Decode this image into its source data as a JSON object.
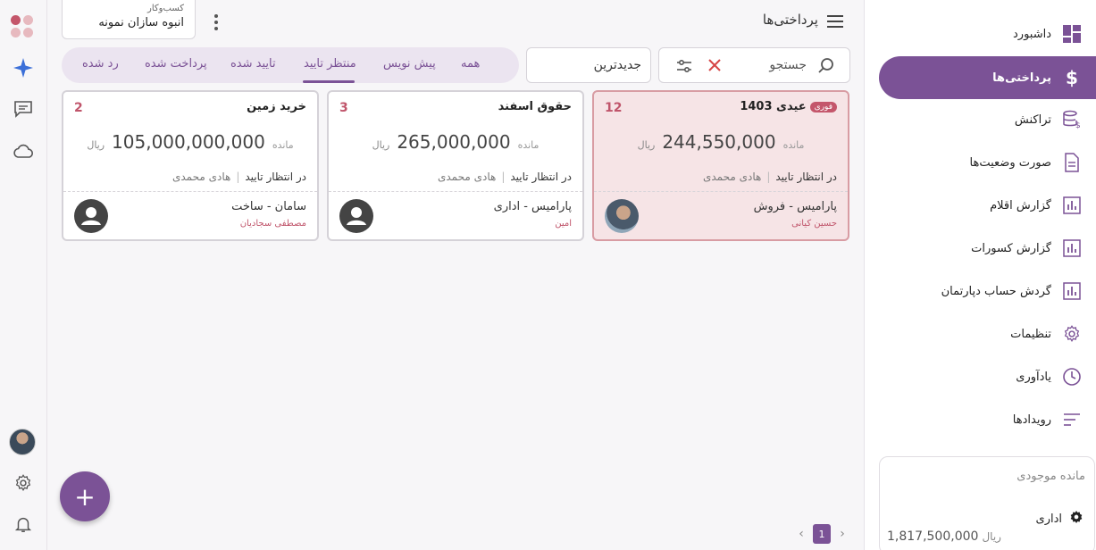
{
  "header": {
    "title": "پرداختی‌ها",
    "business_label": "کسب‌وکار",
    "business_name": "انبوه سازان نمونه"
  },
  "toolbar": {
    "search_placeholder": "جستجو",
    "sort_value": "جدیدترین"
  },
  "tabs": [
    {
      "label": "همه"
    },
    {
      "label": "پیش نویس"
    },
    {
      "label": "منتظر تایید",
      "active": true
    },
    {
      "label": "تایید شده"
    },
    {
      "label": "پرداخت شده"
    },
    {
      "label": "رد شده"
    }
  ],
  "cards": [
    {
      "title": "عیدی 1403",
      "badge": "فوری",
      "count": "12",
      "remain_label": "مانده",
      "amount": "244,550,000",
      "unit": "ریال",
      "status": "در انتظار تایید",
      "approver": "هادی محمدی",
      "department": "پارامیس  -  فروش",
      "person": "حسین کیانی",
      "urgent": true
    },
    {
      "title": "حقوق اسفند",
      "count": "3",
      "remain_label": "مانده",
      "amount": "265,000,000",
      "unit": "ریال",
      "status": "در انتظار تایید",
      "approver": "هادی محمدی",
      "department": "پارامیس  -  اداری",
      "person": "امین"
    },
    {
      "title": "خرید زمین",
      "count": "2",
      "remain_label": "مانده",
      "amount": "105,000,000,000",
      "unit": "ریال",
      "status": "در انتظار تایید",
      "approver": "هادی محمدی",
      "department": "سامان  -  ساخت",
      "person": "مصطفی سجادیان"
    }
  ],
  "sidebar": {
    "items": [
      {
        "label": "داشبورد",
        "icon": "dashboard-icon"
      },
      {
        "label": "پرداختی‌ها",
        "icon": "dollar-icon",
        "active": true
      },
      {
        "label": "تراکنش",
        "icon": "database-dollar-icon"
      },
      {
        "label": "صورت وضعیت‌ها",
        "icon": "document-icon"
      },
      {
        "label": "گزارش اقلام",
        "icon": "report-chart-icon"
      },
      {
        "label": "گزارش کسورات",
        "icon": "report-chart-icon"
      },
      {
        "label": "گردش حساب دپارتمان",
        "icon": "report-chart-icon"
      },
      {
        "label": "تنظیمات",
        "icon": "gear-icon"
      },
      {
        "label": "یادآوری",
        "icon": "clock-icon"
      },
      {
        "label": "رویدادها",
        "icon": "events-icon"
      }
    ],
    "balance": {
      "title": "مانده موجودی",
      "department": "اداری",
      "amount": "1,817,500,000",
      "unit": "ریال"
    }
  },
  "pagination": {
    "current_page": "1"
  },
  "colors": {
    "accent": "#7b5296",
    "urgent_bg": "#f6e4e6",
    "count_red": "#c0556b"
  }
}
